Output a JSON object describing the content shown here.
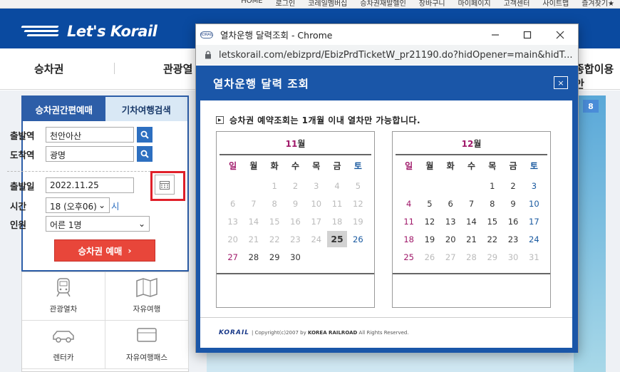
{
  "top_links": [
    "HOME",
    "로그인",
    "코레일멤버십",
    "승차권재발헬인",
    "장바구니",
    "마이페이지",
    "고객센터",
    "사이트맵",
    "즐겨찾기★"
  ],
  "site": {
    "logo_text": "Let's Korail",
    "nav": [
      "승차권",
      "관광열",
      "종합이용안"
    ],
    "badge": "8"
  },
  "booking": {
    "tab_active": "승차권간편예매",
    "tab_inactive": "기차여행검색",
    "depart_label": "출발역",
    "depart_value": "천안아산",
    "arrive_label": "도착역",
    "arrive_value": "광명",
    "date_label": "출발일",
    "date_value": "2022.11.25",
    "time_label": "시간",
    "time_value": "18 (오후06)",
    "time_suffix": "시",
    "people_label": "인원",
    "people_value": "어른 1명",
    "book_button": "승차권 예매"
  },
  "quick_menu": [
    "관광열차",
    "자유여행",
    "렌터카",
    "자유여행패스"
  ],
  "chrome": {
    "window_title": "열차운행 달력조회 - Chrome",
    "favicon_text": "KORAIL",
    "url": "letskorail.com/ebizprd/EbizPrdTicketW_pr21190.do?hidOpener=main&hidT..."
  },
  "dialog": {
    "title": "열차운행 달력 조회",
    "close": "×",
    "notice": "승차권 예약조회는 1개월 이내 열차만 가능합니다.",
    "weekdays": [
      "일",
      "월",
      "화",
      "수",
      "목",
      "금",
      "토"
    ],
    "months": [
      {
        "label": "11월",
        "label_num": "11",
        "label_unit": "월",
        "weeks": [
          [
            "",
            "",
            "1",
            "2",
            "3",
            "4",
            "5"
          ],
          [
            "6",
            "7",
            "8",
            "9",
            "10",
            "11",
            "12"
          ],
          [
            "13",
            "14",
            "15",
            "16",
            "17",
            "18",
            "19"
          ],
          [
            "20",
            "21",
            "22",
            "23",
            "24",
            "25",
            "26"
          ],
          [
            "27",
            "28",
            "29",
            "30",
            "",
            "",
            ""
          ]
        ],
        "enabled_from": 25,
        "enabled_to": 30,
        "selected": 25
      },
      {
        "label": "12월",
        "label_num": "12",
        "label_unit": "월",
        "weeks": [
          [
            "",
            "",
            "",
            "",
            "1",
            "2",
            "3"
          ],
          [
            "4",
            "5",
            "6",
            "7",
            "8",
            "9",
            "10"
          ],
          [
            "11",
            "12",
            "13",
            "14",
            "15",
            "16",
            "17"
          ],
          [
            "18",
            "19",
            "20",
            "21",
            "22",
            "23",
            "24"
          ],
          [
            "25",
            "26",
            "27",
            "28",
            "29",
            "30",
            "31"
          ]
        ],
        "enabled_from": 1,
        "enabled_to": 25,
        "selected": null
      }
    ],
    "footer_logo": "KORAIL",
    "footer_copy_pre": "Copyright(c)2007 by",
    "footer_copy_bold": "KOREA RAILROAD",
    "footer_copy_post": "All Rights Reserved."
  },
  "colors": {
    "brand_blue": "#0a4aa0",
    "dialog_blue": "#1a56a8",
    "sunday": "#a0196a",
    "saturday": "#1a5aa0",
    "book_red": "#e8463a",
    "highlight_red": "#e0202a"
  }
}
